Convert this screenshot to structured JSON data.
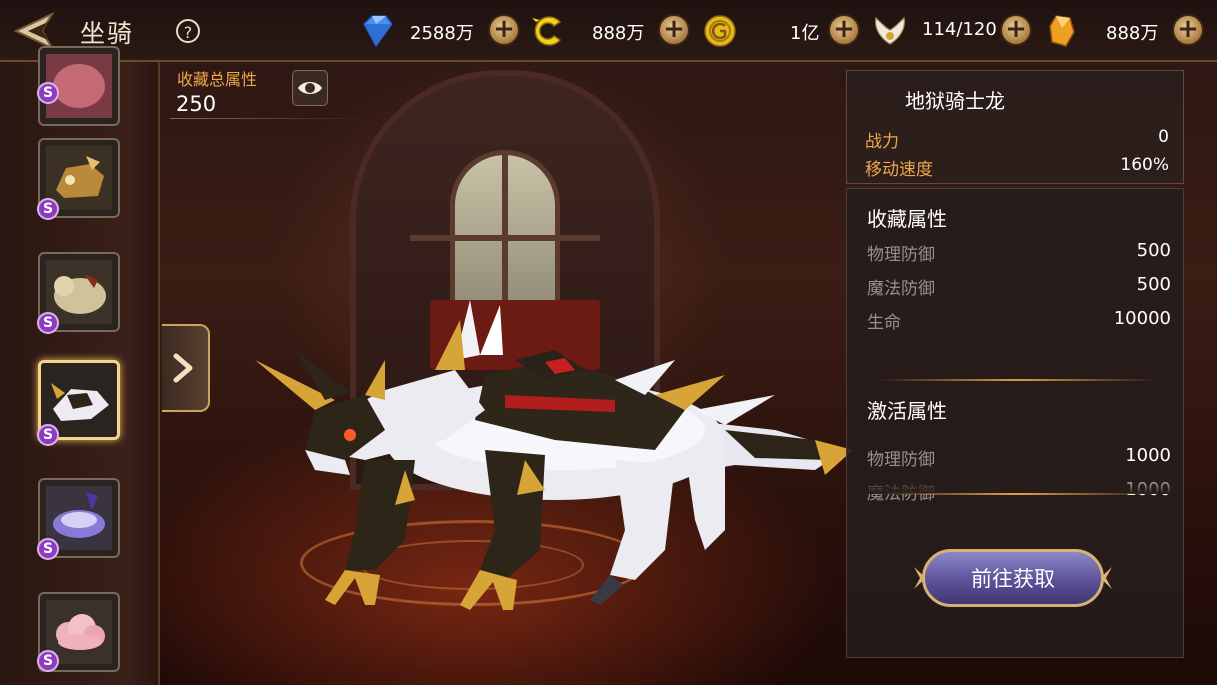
{
  "header": {
    "title": "坐骑",
    "help_symbol": "?",
    "currencies": [
      {
        "icon": "diamond-icon",
        "value": "2588万"
      },
      {
        "icon": "c-coin-icon",
        "value": "888万"
      },
      {
        "icon": "gold-coin-icon",
        "value": "1亿"
      },
      {
        "icon": "wing-stamina-icon",
        "value": "114/120"
      },
      {
        "icon": "amber-crystal-icon",
        "value": "888万"
      }
    ],
    "add_symbol": "+"
  },
  "mount_list": {
    "badge": "S",
    "items": [
      {
        "name": "pink-mount-thumbnail",
        "selected": false
      },
      {
        "name": "golden-beast-thumbnail",
        "selected": false
      },
      {
        "name": "armored-tiger-thumbnail",
        "selected": false
      },
      {
        "name": "hell-knight-dragon-thumbnail",
        "selected": true
      },
      {
        "name": "purple-vehicle-thumbnail",
        "selected": false
      },
      {
        "name": "pink-cloud-thumbnail",
        "selected": false
      }
    ]
  },
  "collection": {
    "label": "收藏总属性",
    "value": "250"
  },
  "mount": {
    "name": "地狱骑士龙",
    "stats": [
      {
        "label": "战力",
        "value": "0"
      },
      {
        "label": "移动速度",
        "value": "160%"
      }
    ],
    "collect_title": "收藏属性",
    "collect_attrs": [
      {
        "label": "物理防御",
        "value": "500"
      },
      {
        "label": "魔法防御",
        "value": "500"
      },
      {
        "label": "生命",
        "value": "10000"
      }
    ],
    "activate_title": "激活属性",
    "activate_attrs": [
      {
        "label": "物理防御",
        "value": "1000"
      },
      {
        "label": "魔法防御",
        "value": "1000"
      }
    ]
  },
  "actions": {
    "go_obtain": "前往获取"
  }
}
